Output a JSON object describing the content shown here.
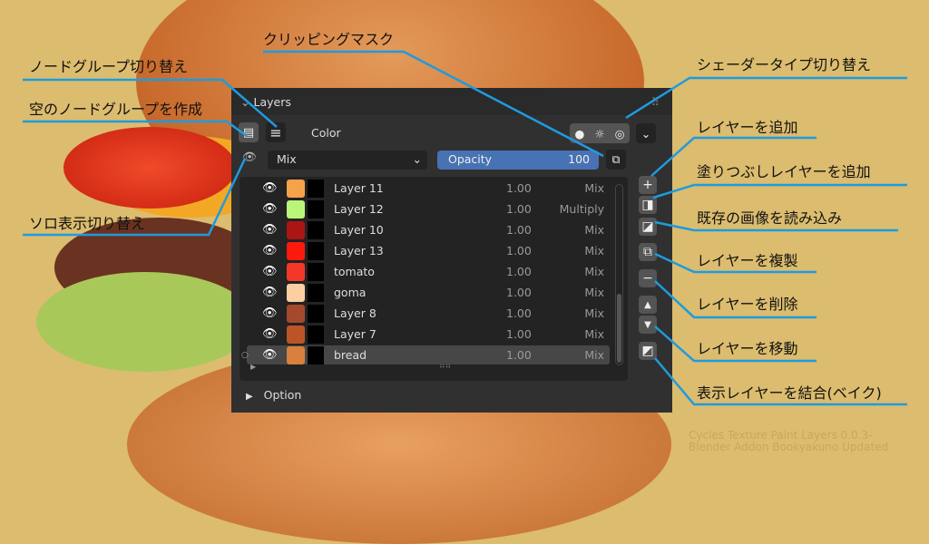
{
  "panel": {
    "title": "Layers",
    "section": "Color",
    "blend_mode": "Mix",
    "opacity_label": "Opacity",
    "opacity_value": "100",
    "option_label": "Option"
  },
  "layers": [
    {
      "name": "Layer 11",
      "opacity": "1.00",
      "blend": "Mix",
      "color": "#f6a24a"
    },
    {
      "name": "Layer 12",
      "opacity": "1.00",
      "blend": "Multiply",
      "color": "#baf57a"
    },
    {
      "name": "Layer 10",
      "opacity": "1.00",
      "blend": "Mix",
      "color": "#ad1414"
    },
    {
      "name": "Layer 13",
      "opacity": "1.00",
      "blend": "Mix",
      "color": "#fb1a0c"
    },
    {
      "name": "tomato",
      "opacity": "1.00",
      "blend": "Mix",
      "color": "#f43828"
    },
    {
      "name": "goma",
      "opacity": "1.00",
      "blend": "Mix",
      "color": "#fccfa0"
    },
    {
      "name": "Layer 8",
      "opacity": "1.00",
      "blend": "Mix",
      "color": "#a5492c"
    },
    {
      "name": "Layer 7",
      "opacity": "1.00",
      "blend": "Mix",
      "color": "#bd5428"
    },
    {
      "name": "bread",
      "opacity": "1.00",
      "blend": "Mix",
      "color": "#d8803c"
    }
  ],
  "annotations": {
    "node_group_toggle": "ノードグループ切り替え",
    "empty_node_group": "空のノードグループを作成",
    "solo_toggle": "ソロ表示切り替え",
    "clipping_mask": "クリッピングマスク",
    "shader_type": "シェーダータイプ切り替え",
    "add_layer": "レイヤーを追加",
    "add_fill_layer": "塗りつぶしレイヤーを追加",
    "load_image": "既存の画像を読み込み",
    "duplicate_layer": "レイヤーを複製",
    "delete_layer": "レイヤーを削除",
    "move_layer": "レイヤーを移動",
    "merge_bake": "表示レイヤーを結合(ベイク)"
  },
  "credit": {
    "line1": "Cycles Texture Paint Layers 0.0.3-",
    "line2": "Blender Addon Bookyakuno Updated"
  },
  "colors": {
    "accent": "#1e9be0",
    "opacity_bar": "#4772b3"
  }
}
